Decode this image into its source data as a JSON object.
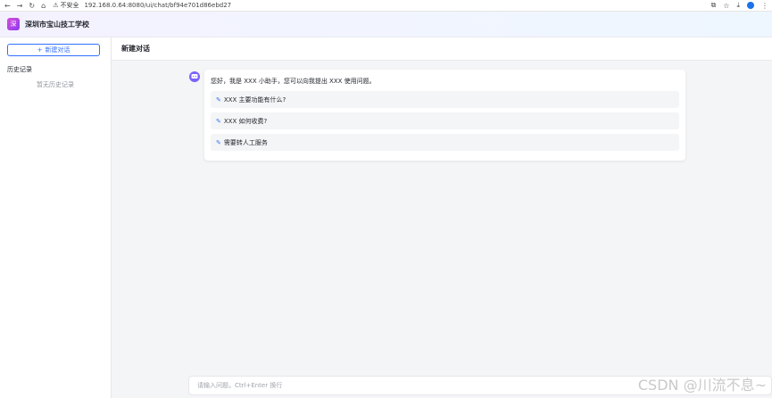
{
  "browser": {
    "insecure_label": "不安全",
    "url": "192.168.0.64:8080/ui/chat/bf94e701d86ebd27"
  },
  "app": {
    "logo_text": "深",
    "school_name": "深圳市宝山技工学校"
  },
  "sidebar": {
    "new_chat_label": "新建对话",
    "history_title": "历史记录",
    "history_empty": "暂无历史记录"
  },
  "main": {
    "title": "新建对话",
    "greeting": "您好，我是 XXX 小助手，您可以向我提出 XXX 使用问题。",
    "suggestions": [
      "XXX 主要功能有什么?",
      "XXX 如何收费?",
      "需要转人工服务"
    ]
  },
  "input": {
    "placeholder": "请输入问题，Ctrl+Enter 换行"
  },
  "watermark": "CSDN @川流不息~",
  "colors": {
    "accent": "#3370ff",
    "logo": "#b845e3",
    "bot": "#7b61ff"
  }
}
